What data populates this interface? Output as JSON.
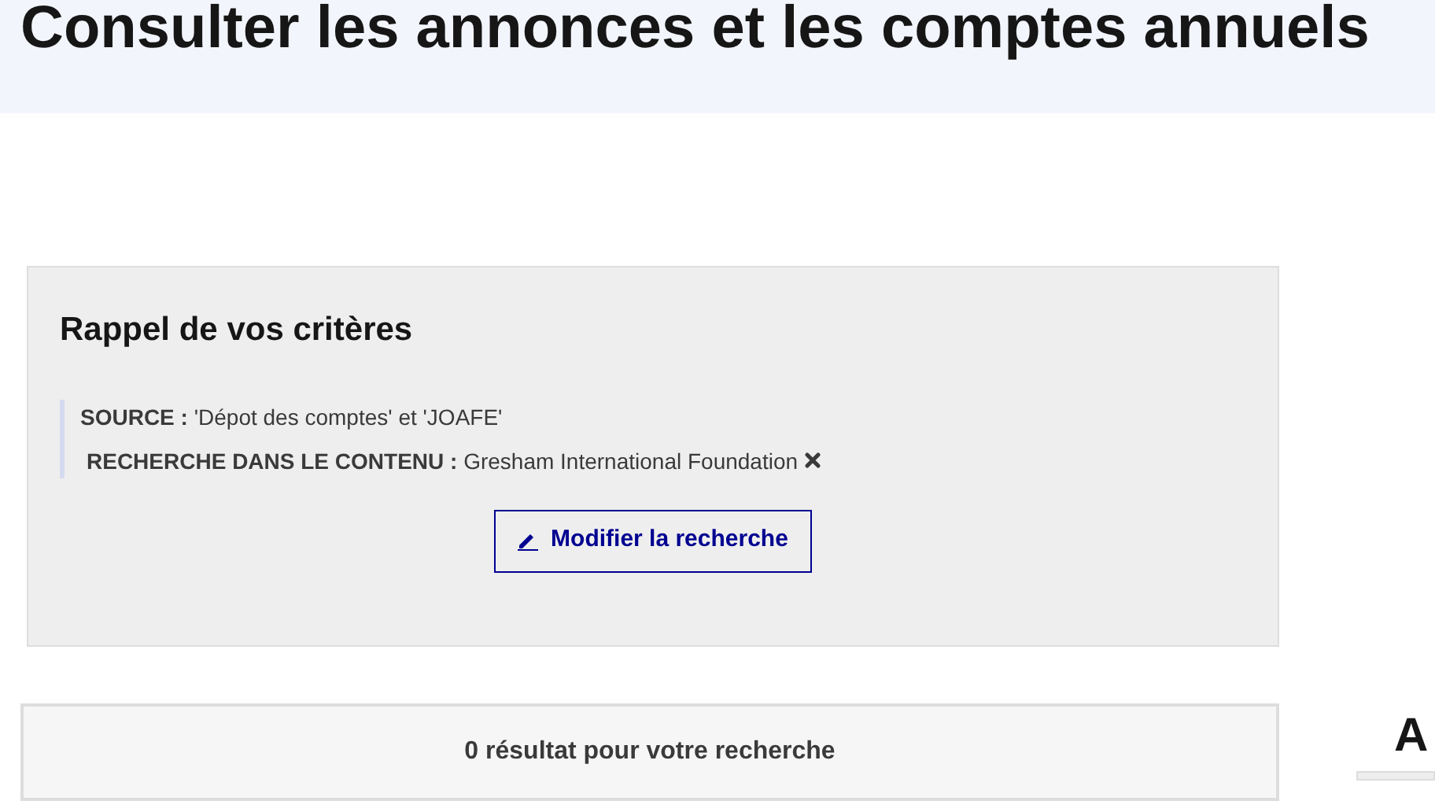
{
  "page_title": "Consulter les annonces et les comptes annuels",
  "criteria": {
    "heading": "Rappel de vos critères",
    "items": [
      {
        "label": "SOURCE :",
        "value": "'Dépot des comptes' et 'JOAFE'",
        "removable": false
      },
      {
        "label": "RECHERCHE DANS LE CONTENU :",
        "value": "Gresham International Foundation",
        "removable": true
      }
    ],
    "button": "Modifier la recherche"
  },
  "results": {
    "summary": "0 résultat pour votre recherche"
  },
  "side_heading": "A"
}
